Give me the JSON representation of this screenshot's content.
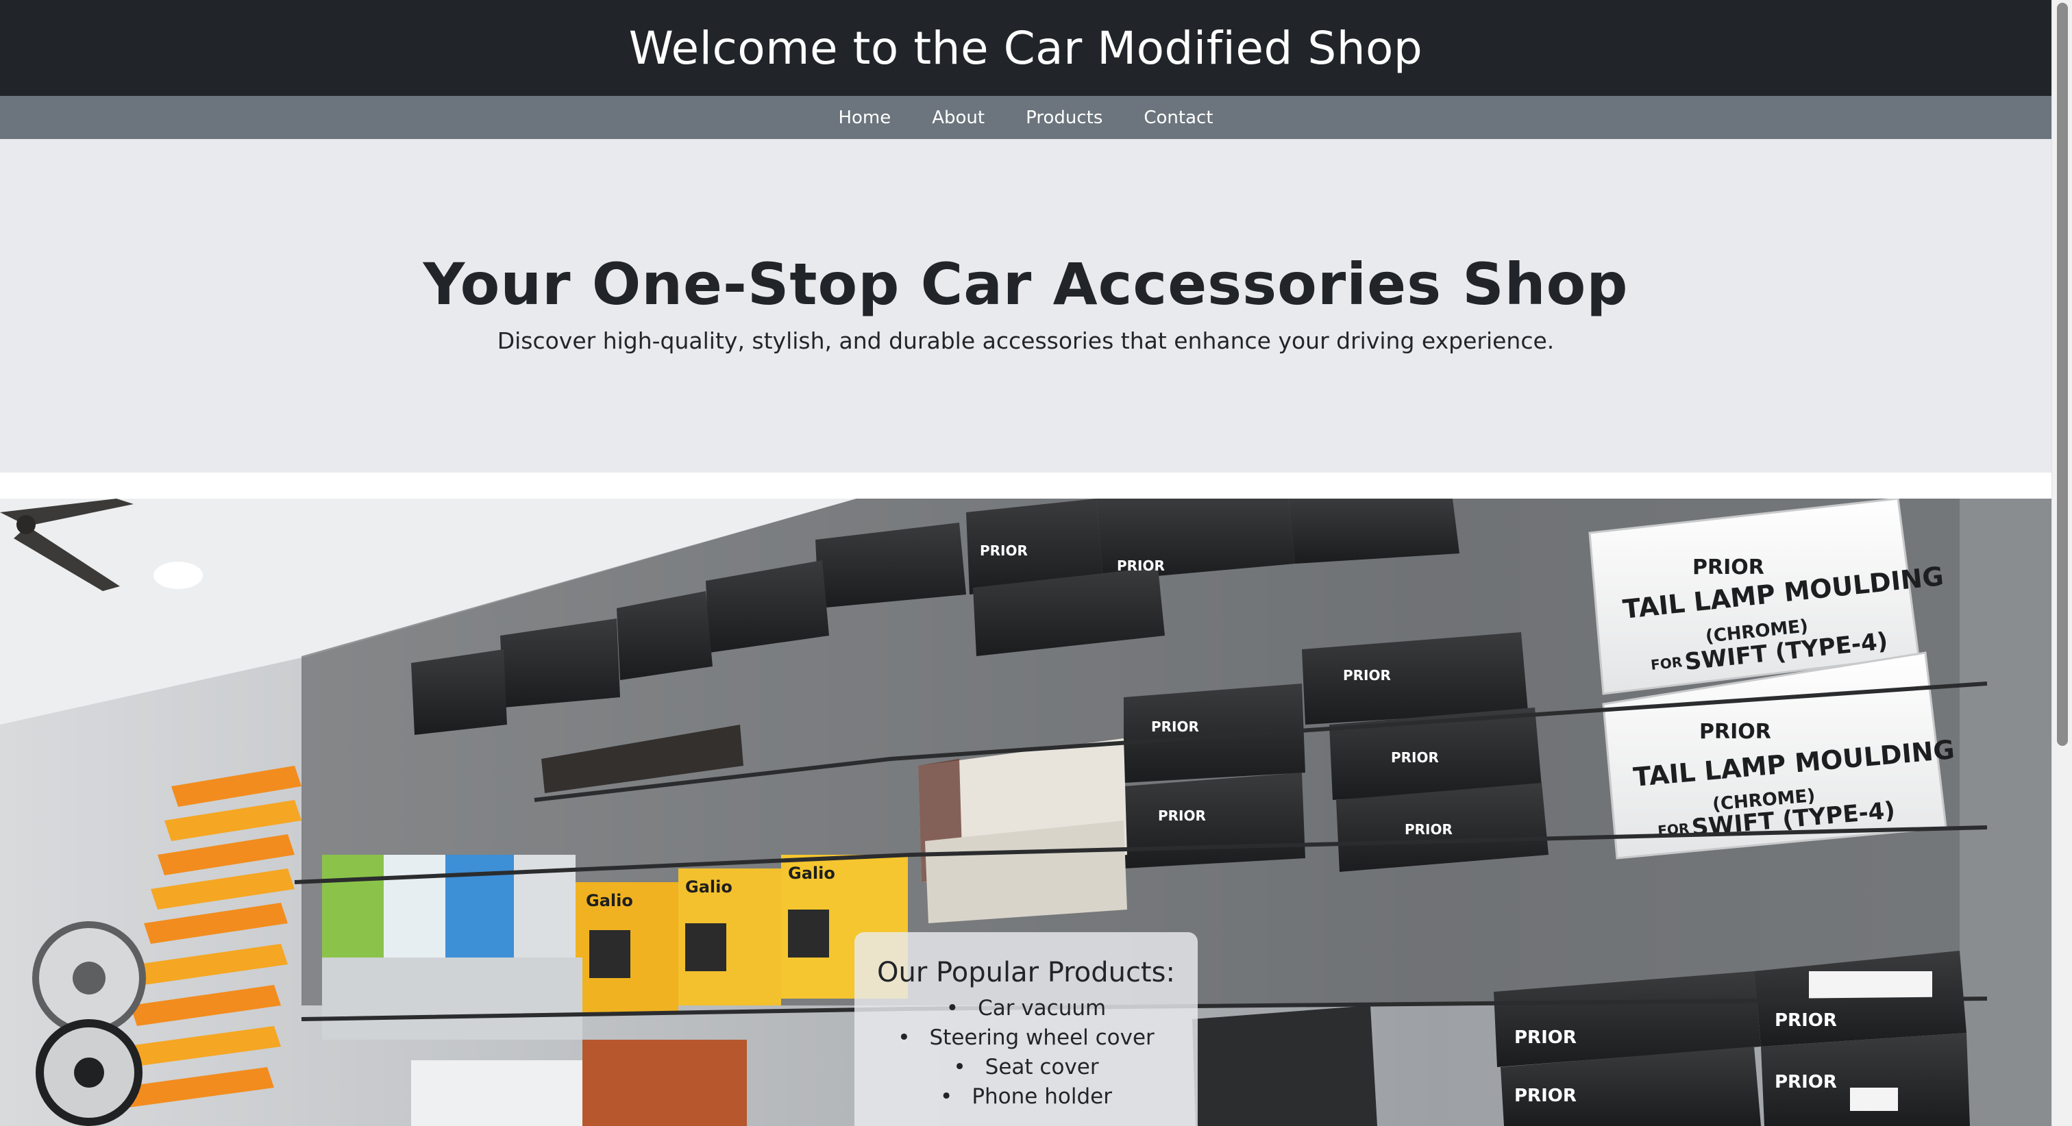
{
  "header": {
    "title": "Welcome to the Car Modified Shop"
  },
  "nav": {
    "items": [
      {
        "label": "Home"
      },
      {
        "label": "About"
      },
      {
        "label": "Products"
      },
      {
        "label": "Contact"
      }
    ]
  },
  "hero": {
    "title": "Your One-Stop Car Accessories Shop",
    "subtitle": "Discover high-quality, stylish, and durable accessories that enhance your driving experience."
  },
  "products": {
    "title": "Our Popular Products:",
    "items": [
      "Car vacuum",
      "Steering wheel cover",
      "Seat cover",
      "Phone holder"
    ]
  },
  "photo": {
    "box_brand": "PRIOR",
    "box_label_1": "TAIL LAMP MOULDING",
    "box_label_2": "(CHROME)",
    "box_label_3": "FOR",
    "box_label_4": "SWIFT (TYPE-4)",
    "galio_brand": "Galio"
  },
  "colors": {
    "header_bg": "#212529",
    "nav_bg": "#6c757d",
    "hero_bg": "#e9eaee"
  }
}
